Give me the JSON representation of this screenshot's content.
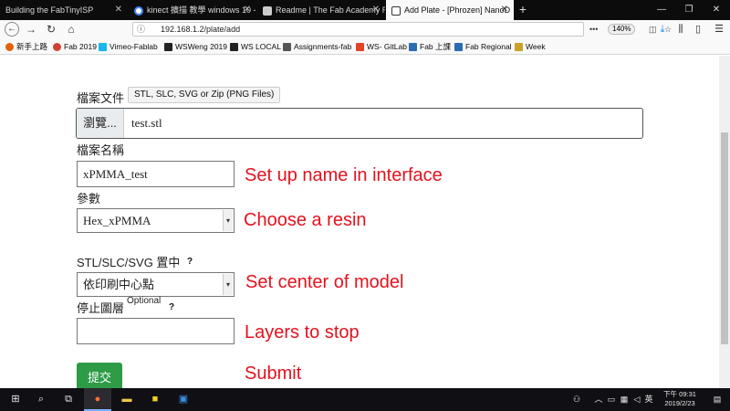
{
  "browser": {
    "tabs": [
      {
        "title": "Building the FabTinyISP",
        "active": false
      },
      {
        "title": "kinect 擴描 教學 windows 10 -",
        "active": false
      },
      {
        "title": "Readme | The Fab Academy R",
        "active": false
      },
      {
        "title": "Add Plate - [Phrozen] NanoD",
        "active": true
      }
    ],
    "new_tab_label": "+",
    "window_controls": {
      "minimize": "—",
      "restore": "❐",
      "close": "✕"
    },
    "url": "192.168.1.2/plate/add",
    "zoom": "140%",
    "bookmarks": [
      {
        "label": "新手上路",
        "color": "#e66000"
      },
      {
        "label": "Fab 2019",
        "color": "#d04030"
      },
      {
        "label": "Vimeo-Fablab",
        "color": "#1ab7ea"
      },
      {
        "label": "WSWeng 2019",
        "color": "#222222"
      },
      {
        "label": "WS LOCAL",
        "color": "#222222"
      },
      {
        "label": "Assignments-fab",
        "color": "#555555"
      },
      {
        "label": "WS- GitLab",
        "color": "#e24329"
      },
      {
        "label": "Fab 上課",
        "color": "#2b6cb0"
      },
      {
        "label": "Fab Regional",
        "color": "#2b6cb0"
      },
      {
        "label": "Week",
        "color": "#c9a227"
      }
    ]
  },
  "form": {
    "file_label": "檔案文件",
    "file_types_hint": "STL, SLC, SVG or Zip (PNG Files)",
    "browse_button": "瀏覽...",
    "file_name": "test.stl",
    "name_label": "檔案名稱",
    "name_value": "xPMMA_test",
    "param_label": "參數",
    "param_value": "Hex_xPMMA",
    "center_label": "STL/SLC/SVG 置中",
    "center_help": "?",
    "center_value": "依印刷中心點",
    "stop_label": "停止圖層",
    "stop_optional": "Optional",
    "stop_help": "?",
    "stop_value": "",
    "submit_label": "提交"
  },
  "annotations": {
    "name": "Set up name in interface",
    "resin": "Choose a resin",
    "center": "Set center of model",
    "layers": "Layers to stop",
    "submit": "Submit",
    "color": "#e3121e"
  },
  "taskbar": {
    "time": "下午 09:31",
    "date": "2019/2/23"
  }
}
